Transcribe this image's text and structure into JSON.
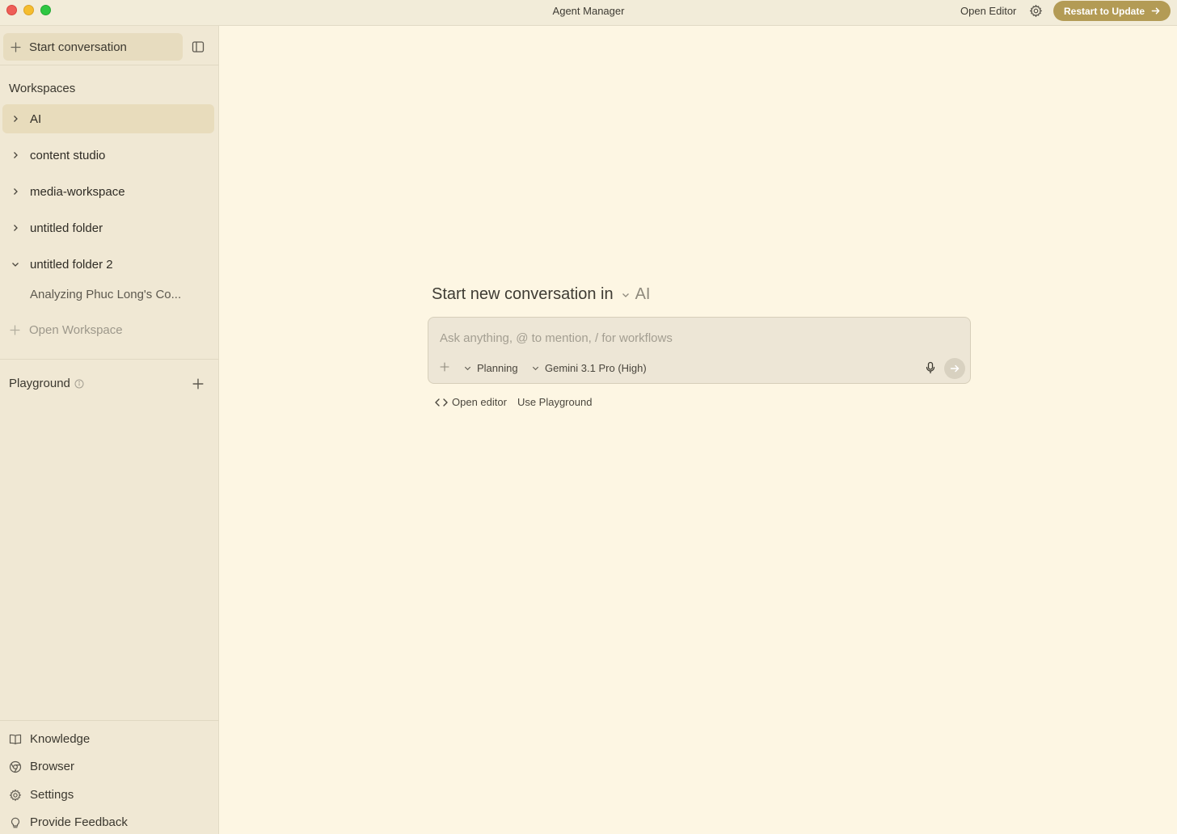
{
  "window": {
    "title": "Agent Manager",
    "open_editor_label": "Open Editor",
    "restart_label": "Restart to Update",
    "accent_color": "#b39b55"
  },
  "sidebar": {
    "start_conversation_label": "Start conversation",
    "workspaces_heading": "Workspaces",
    "workspaces": [
      {
        "label": "AI",
        "expanded": false,
        "active": true
      },
      {
        "label": "content studio",
        "expanded": false,
        "active": false
      },
      {
        "label": "media-workspace",
        "expanded": false,
        "active": false
      },
      {
        "label": "untitled folder",
        "expanded": false,
        "active": false
      },
      {
        "label": "untitled folder 2",
        "expanded": true,
        "active": false
      }
    ],
    "conversation_item": "Analyzing Phuc Long's Co...",
    "open_workspace_label": "Open Workspace",
    "playground_label": "Playground",
    "bottom_items": [
      {
        "label": "Knowledge",
        "icon": "book-icon"
      },
      {
        "label": "Browser",
        "icon": "chrome-icon"
      },
      {
        "label": "Settings",
        "icon": "gear-icon"
      },
      {
        "label": "Provide Feedback",
        "icon": "lightbulb-icon"
      }
    ]
  },
  "main": {
    "headline": "Start new conversation in",
    "selected_workspace": "AI",
    "input_placeholder": "Ask anything, @ to mention, / for workflows",
    "mode": "Planning",
    "model": "Gemini 3.1 Pro (High)",
    "open_editor_link": "Open editor",
    "use_playground_link": "Use Playground"
  }
}
